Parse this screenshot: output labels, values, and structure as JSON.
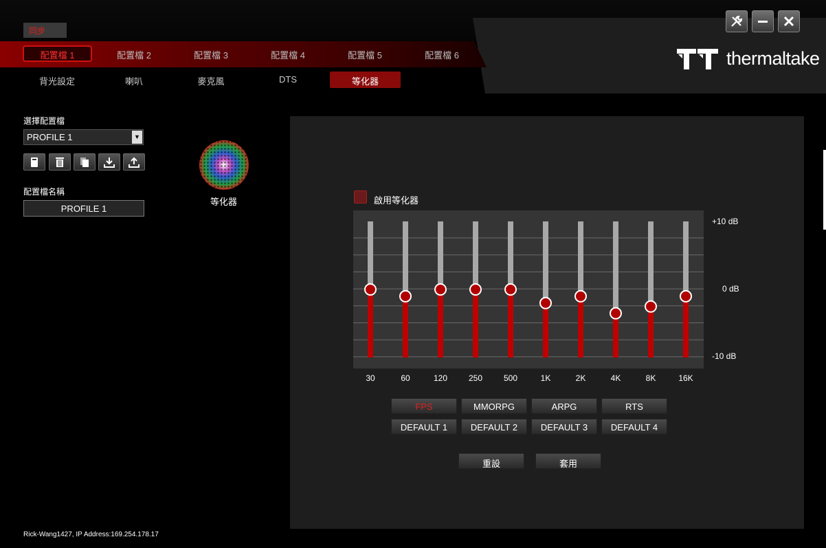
{
  "sync_label": "同步",
  "window_controls": [
    "tools-icon",
    "minimize-icon",
    "close-icon"
  ],
  "brand": {
    "text": "thermaltake"
  },
  "profile_tabs": [
    {
      "label": "配置檔 1",
      "active": true
    },
    {
      "label": "配置檔 2",
      "active": false
    },
    {
      "label": "配置檔 3",
      "active": false
    },
    {
      "label": "配置檔 4",
      "active": false
    },
    {
      "label": "配置檔 5",
      "active": false
    },
    {
      "label": "配置檔 6",
      "active": false
    }
  ],
  "sub_tabs": [
    {
      "label": "背光設定",
      "active": false
    },
    {
      "label": "喇叭",
      "active": false
    },
    {
      "label": "麥克風",
      "active": false
    },
    {
      "label": "DTS",
      "active": false
    },
    {
      "label": "等化器",
      "active": true
    }
  ],
  "sidebar": {
    "select_profile_label": "選擇配置檔",
    "selected_profile": "PROFILE 1",
    "tool_icons": [
      "save-icon",
      "delete-icon",
      "copy-icon",
      "import-icon",
      "export-icon"
    ],
    "profile_name_label": "配置檔名稱",
    "profile_name_value": "PROFILE 1"
  },
  "module": {
    "label": "等化器"
  },
  "equalizer": {
    "enable_label": "啟用等化器",
    "enabled": false,
    "db_labels": [
      "+10 dB",
      "0 dB",
      "-10 dB"
    ],
    "range_db": [
      -10,
      10
    ],
    "bands": [
      {
        "freq": "30",
        "db": 0
      },
      {
        "freq": "60",
        "db": -1
      },
      {
        "freq": "120",
        "db": 0
      },
      {
        "freq": "250",
        "db": 0
      },
      {
        "freq": "500",
        "db": 0
      },
      {
        "freq": "1K",
        "db": -2
      },
      {
        "freq": "2K",
        "db": -1
      },
      {
        "freq": "4K",
        "db": -3.5
      },
      {
        "freq": "8K",
        "db": -2.5
      },
      {
        "freq": "16K",
        "db": -1
      }
    ],
    "fill_color": "#c00000",
    "track_color": "#a8a8a8"
  },
  "presets_row1": [
    {
      "label": "FPS",
      "active": true
    },
    {
      "label": "MMORPG",
      "active": false
    },
    {
      "label": "ARPG",
      "active": false
    },
    {
      "label": "RTS",
      "active": false
    }
  ],
  "presets_row2": [
    {
      "label": "DEFAULT 1"
    },
    {
      "label": "DEFAULT 2"
    },
    {
      "label": "DEFAULT 3"
    },
    {
      "label": "DEFAULT 4"
    }
  ],
  "actions": {
    "reset_label": "重設",
    "apply_label": "套用"
  },
  "footer": "Rick-Wang1427, IP Address:169.254.178.17"
}
